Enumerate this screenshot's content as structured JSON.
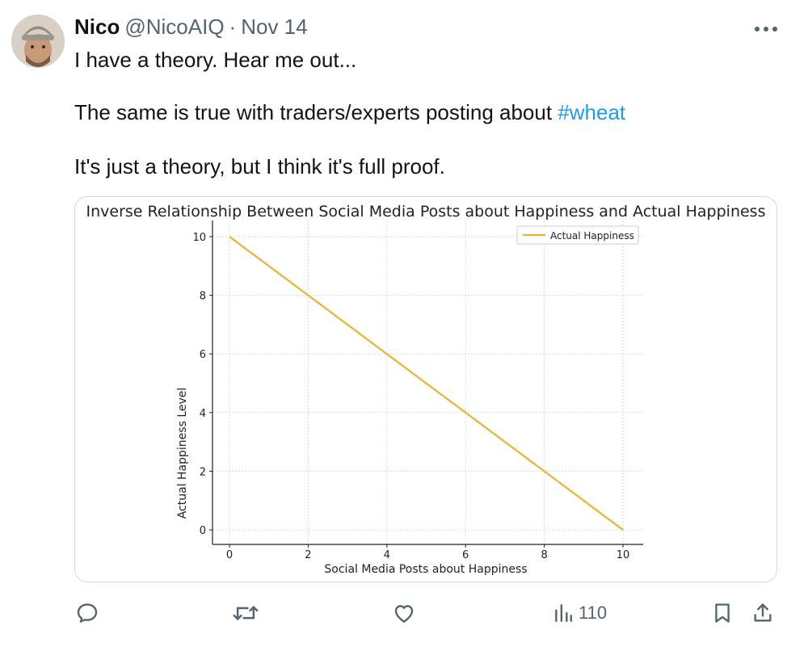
{
  "tweet": {
    "author_name": "Nico",
    "handle": "@NicoAIQ",
    "separator": "·",
    "date": "Nov 14",
    "paragraphs": [
      "I have a theory. Hear me out...",
      "The same is true with traders/experts posting about",
      "It's just a theory, but I think it's full proof."
    ],
    "hashtag": "#wheat",
    "views_count": "110"
  },
  "icons": {
    "more": "more-horizontal-icon",
    "reply": "reply-icon",
    "retweet": "retweet-icon",
    "like": "like-icon",
    "views": "views-bar-chart-icon",
    "bookmark": "bookmark-icon",
    "share": "share-icon"
  },
  "colors": {
    "text": "#0f1419",
    "secondary": "#536471",
    "link": "#1d9bf0",
    "series": "#e6b333"
  },
  "chart_data": {
    "type": "line",
    "title": "Inverse Relationship Between Social Media Posts about Happiness and Actual Happiness",
    "xlabel": "Social Media Posts about Happiness",
    "ylabel": "Actual Happiness Level",
    "x_ticks": [
      0,
      2,
      4,
      6,
      8,
      10
    ],
    "y_ticks": [
      0,
      2,
      4,
      6,
      8,
      10
    ],
    "xlim": [
      0,
      10
    ],
    "ylim": [
      0,
      10
    ],
    "grid": true,
    "legend": "top-right",
    "series": [
      {
        "name": "Actual Happiness",
        "x": [
          0,
          2,
          4,
          6,
          8,
          10
        ],
        "y": [
          10,
          8,
          6,
          4,
          2,
          0
        ]
      }
    ]
  }
}
